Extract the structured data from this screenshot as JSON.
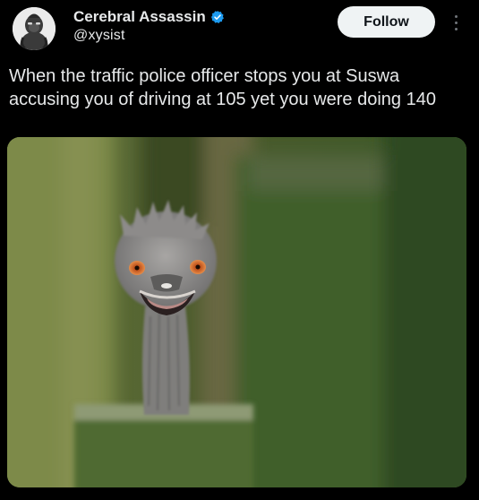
{
  "post": {
    "author": {
      "display_name": "Cerebral Assassin",
      "handle": "@xysist",
      "verified": true,
      "avatar_icon": "gorilla-avatar-icon"
    },
    "follow_label": "Follow",
    "more_icon": "more-vertical-icon",
    "text": "When the traffic police officer stops you at Suswa accusing you of driving at 105 yet you were doing 140",
    "media": {
      "type": "photo",
      "subject": "emu-peeking-photo"
    }
  },
  "colors": {
    "background": "#000000",
    "text": "#e7e9ea",
    "verified": "#1d9bf0",
    "follow_bg": "#eff3f4",
    "follow_text": "#0f1419",
    "muted": "#71767b"
  }
}
